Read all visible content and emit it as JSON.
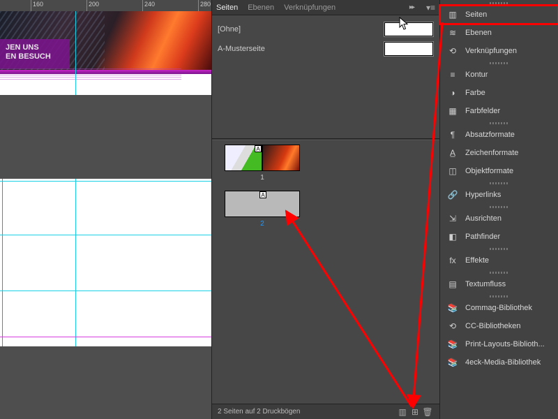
{
  "ruler": {
    "ticks": [
      "160",
      "200",
      "240",
      "280"
    ]
  },
  "canvas": {
    "purple_text_line1": "JEN UNS",
    "purple_text_line2": "EN BESUCH"
  },
  "pages_panel": {
    "tabs": {
      "seiten": "Seiten",
      "ebenen": "Ebenen",
      "verkn": "Verknüpfungen"
    },
    "masters": {
      "none_label": "[Ohne]",
      "a_master_label": "A-Musterseite"
    },
    "spreads": {
      "s1": {
        "caption": "1",
        "master_tag": "A"
      },
      "s2": {
        "caption": "2",
        "master_tag": "A"
      }
    },
    "footer": "2 Seiten auf 2 Druckbögen"
  },
  "dock": {
    "groups": [
      [
        {
          "key": "seiten",
          "label": "Seiten",
          "hl": true
        },
        {
          "key": "ebenen",
          "label": "Ebenen"
        },
        {
          "key": "verkn",
          "label": "Verknüpfungen"
        }
      ],
      [
        {
          "key": "kontur",
          "label": "Kontur"
        },
        {
          "key": "farbe",
          "label": "Farbe"
        },
        {
          "key": "farbfelder",
          "label": "Farbfelder"
        }
      ],
      [
        {
          "key": "absatz",
          "label": "Absatzformate"
        },
        {
          "key": "zeichen",
          "label": "Zeichenformate"
        },
        {
          "key": "objekt",
          "label": "Objektformate"
        }
      ],
      [
        {
          "key": "hyper",
          "label": "Hyperlinks"
        }
      ],
      [
        {
          "key": "ausrichten",
          "label": "Ausrichten"
        },
        {
          "key": "pathfinder",
          "label": "Pathfinder"
        }
      ],
      [
        {
          "key": "effekte",
          "label": "Effekte"
        }
      ],
      [
        {
          "key": "textumfluss",
          "label": "Textumfluss"
        }
      ],
      [
        {
          "key": "commag",
          "label": "Commag-Bibliothek"
        },
        {
          "key": "cc",
          "label": "CC-Bibliotheken"
        },
        {
          "key": "print",
          "label": "Print-Layouts-Biblioth..."
        },
        {
          "key": "4eck",
          "label": "4eck-Media-Bibliothek"
        }
      ]
    ]
  },
  "icons": {
    "seiten": "▥",
    "ebenen": "≋",
    "verkn": "⟲",
    "kontur": "≡",
    "farbe": "◑",
    "farbfelder": "▦",
    "absatz": "¶",
    "zeichen": "A̲",
    "objekt": "◫",
    "hyper": "🔗",
    "ausrichten": "⇲",
    "pathfinder": "◧",
    "effekte": "fx",
    "textumfluss": "▤",
    "commag": "📚",
    "cc": "⟲",
    "print": "📚",
    "4eck": "📚",
    "expander": "▸▸",
    "menu": "▾≡",
    "newpage": "⊞",
    "trash": "🗑",
    "opts": "▥"
  }
}
